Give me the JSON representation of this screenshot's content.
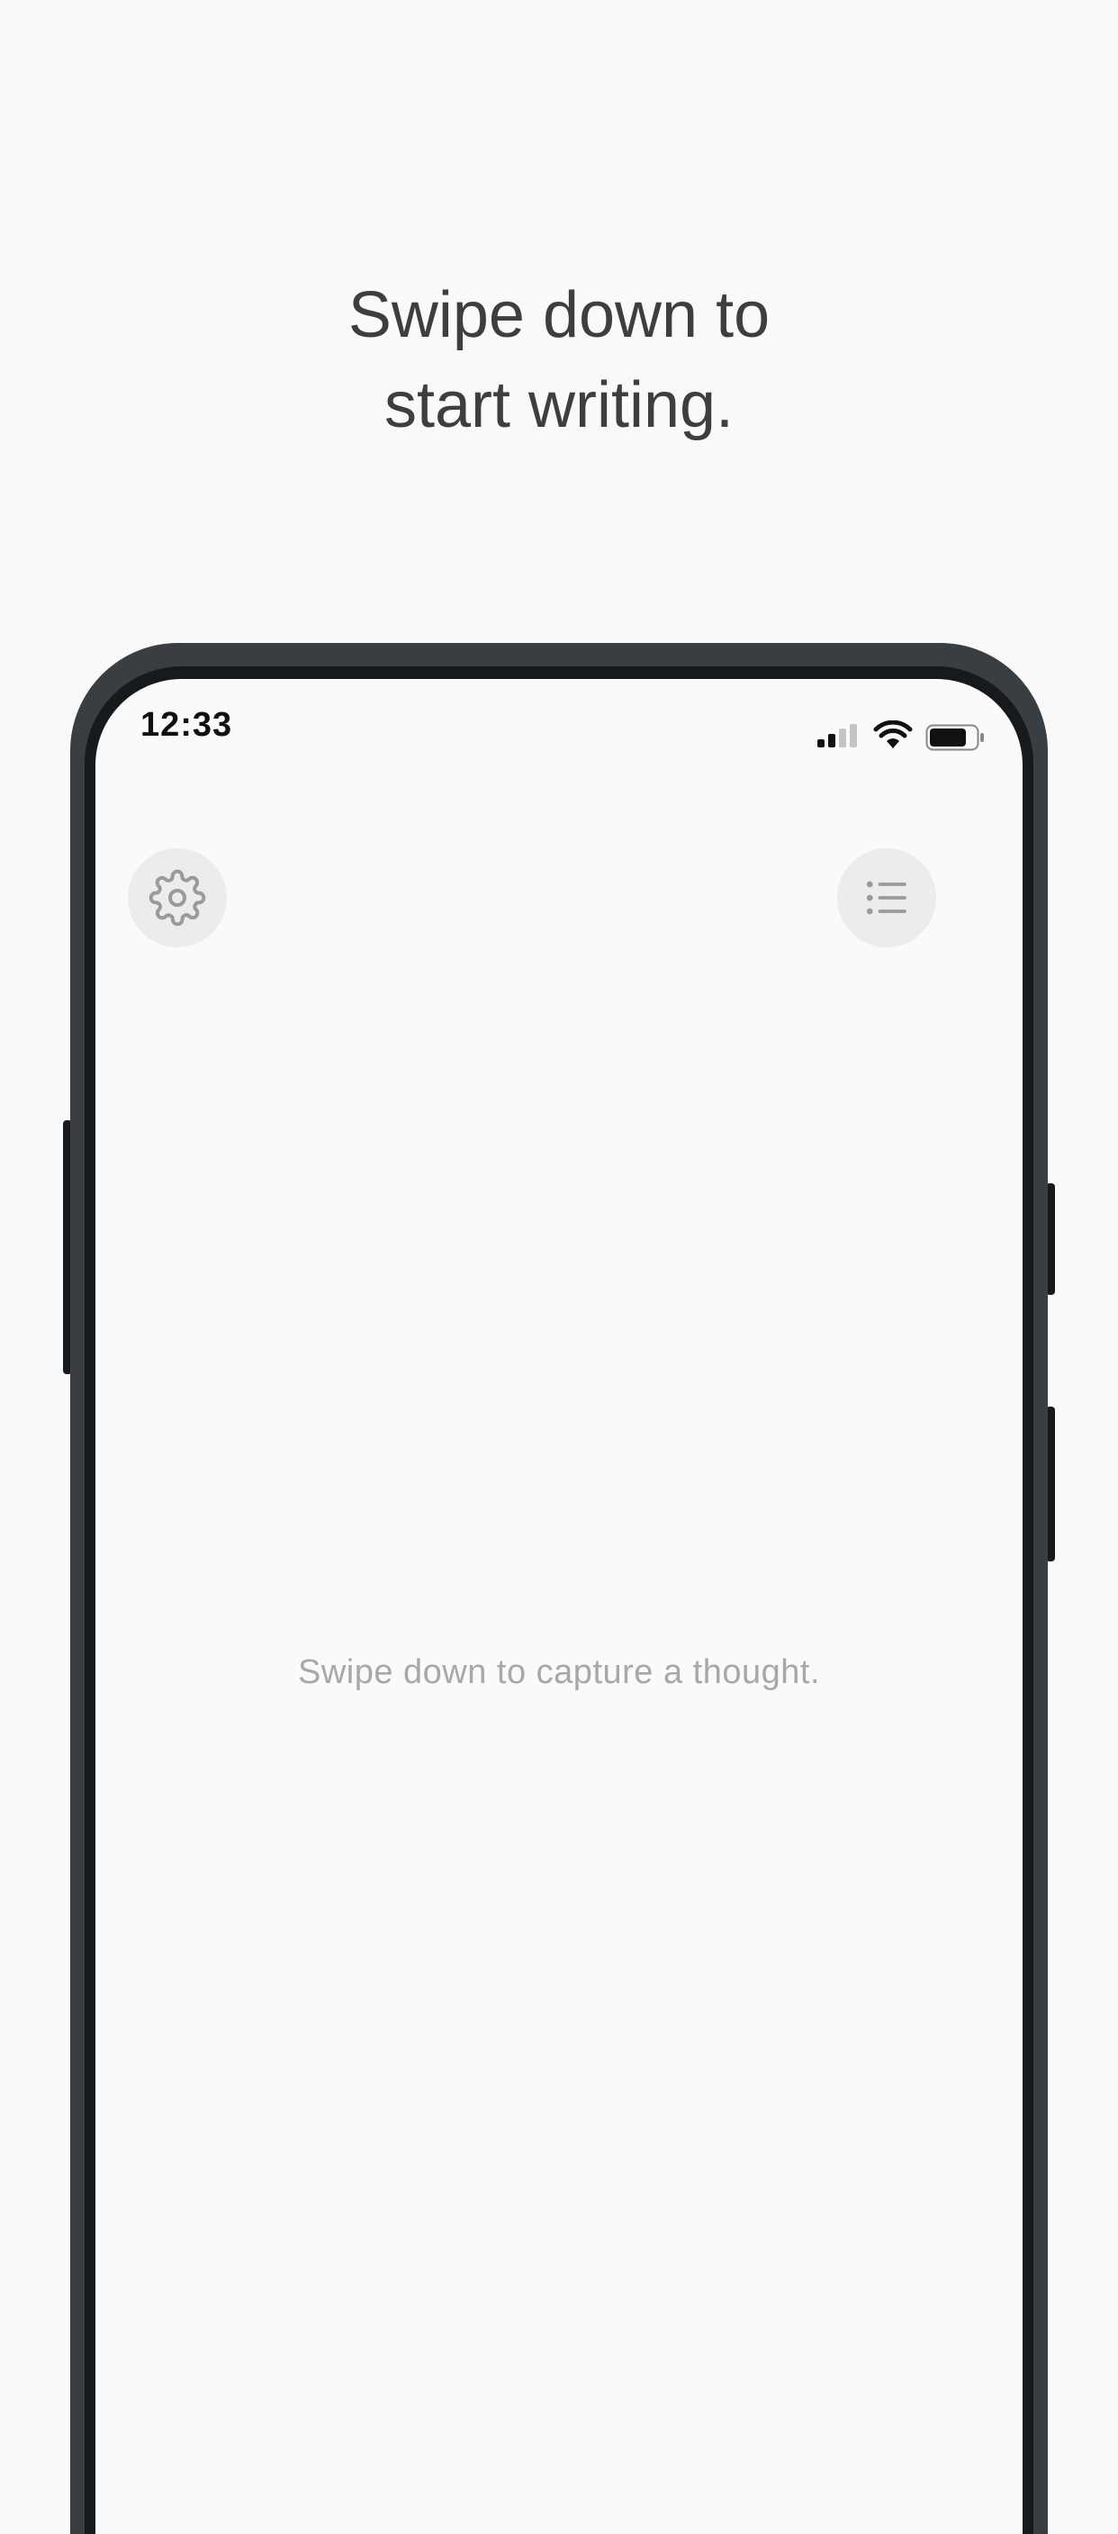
{
  "headline": {
    "line1": "Swipe down to",
    "line2": "start writing."
  },
  "status_bar": {
    "time": "12:33",
    "icons": [
      "signal-icon",
      "wifi-icon",
      "battery-icon"
    ]
  },
  "toolbar": {
    "settings_icon": "gear-icon",
    "list_icon": "list-icon"
  },
  "empty_state": {
    "hint": "Swipe down to capture a thought."
  },
  "colors": {
    "background": "#f9f9f9",
    "frame": "#383e42",
    "headline_text": "#3e3e3e",
    "hint_text": "#a8a8a8",
    "button_bg": "#ececec",
    "icon": "#9a9a9a"
  }
}
